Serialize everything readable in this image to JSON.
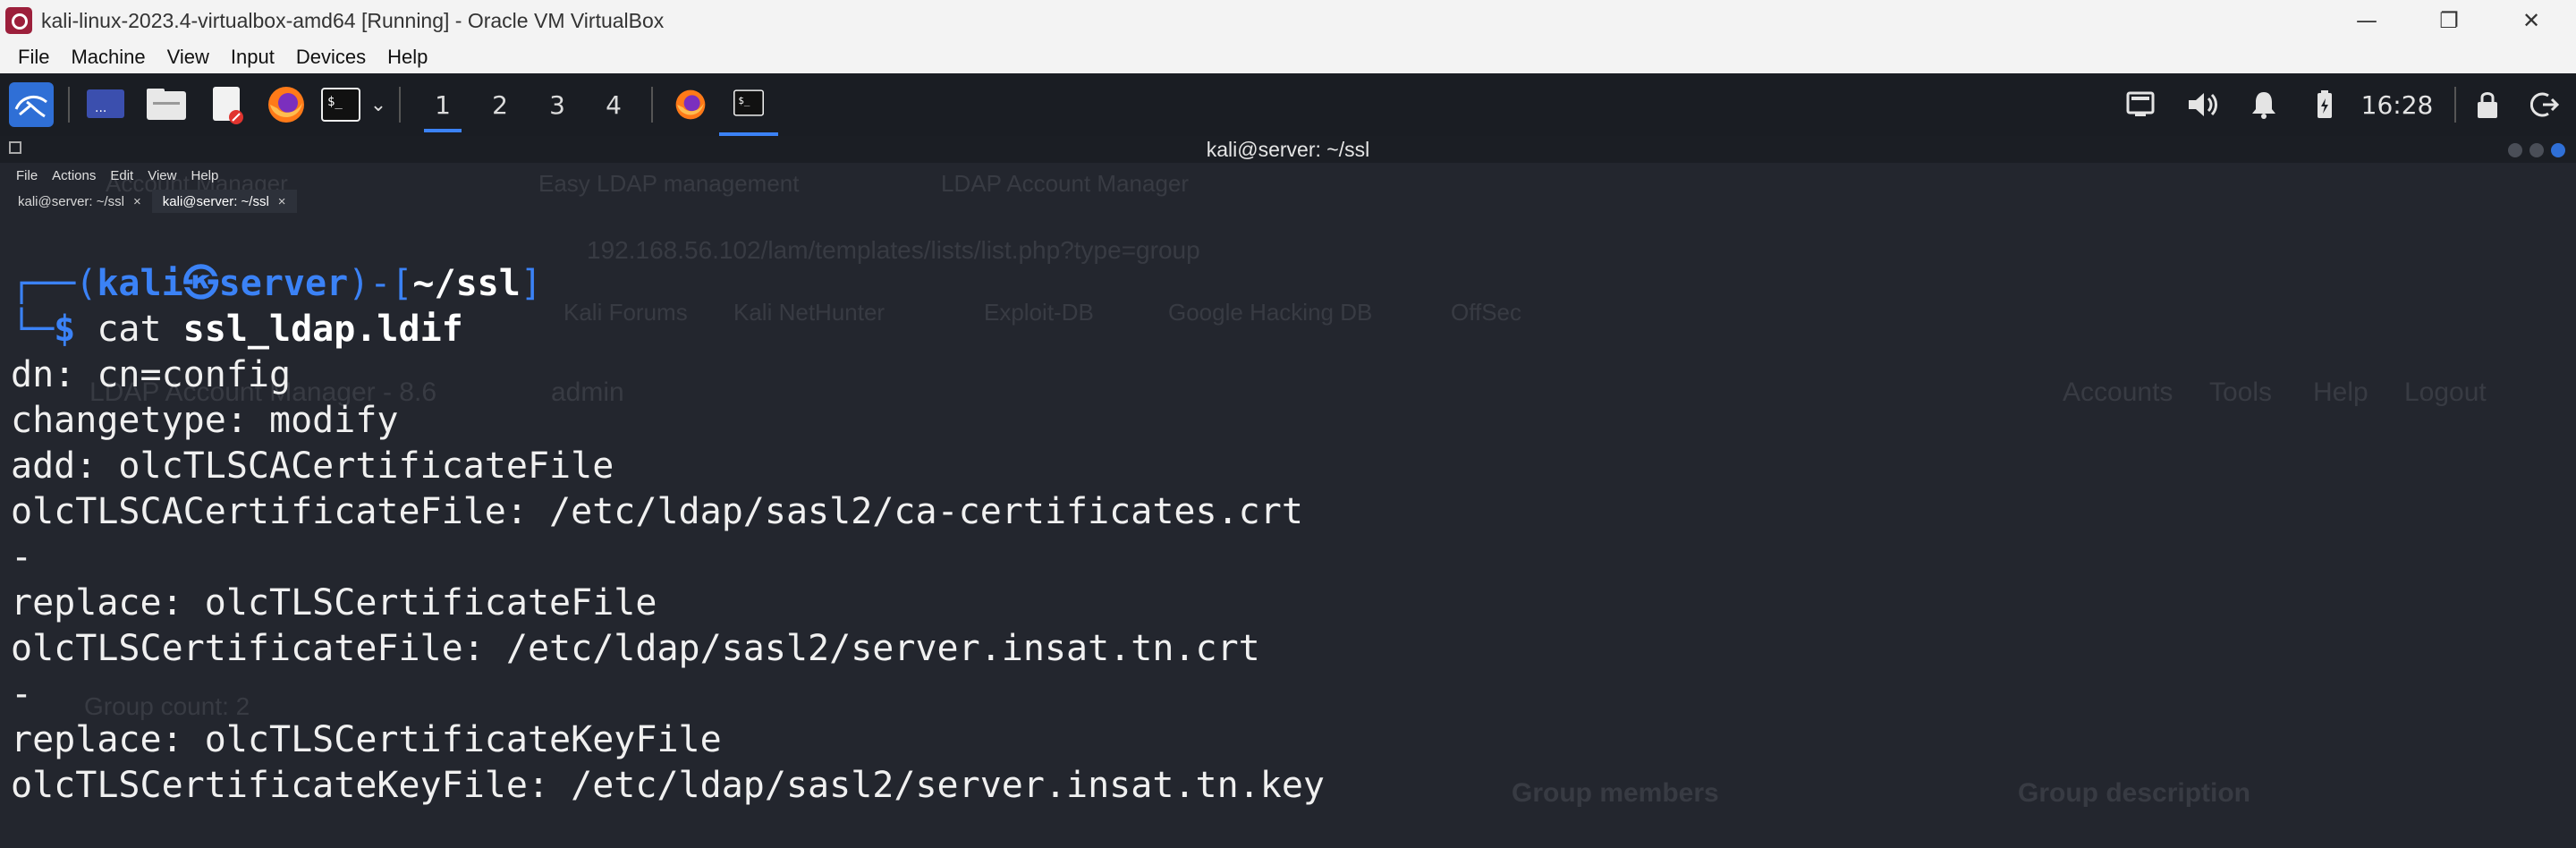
{
  "host_window": {
    "title": "kali-linux-2023.4-virtualbox-amd64 [Running] - Oracle VM VirtualBox"
  },
  "vbox_menu": [
    "File",
    "Machine",
    "View",
    "Input",
    "Devices",
    "Help"
  ],
  "panel": {
    "workspaces": [
      "1",
      "2",
      "3",
      "4"
    ],
    "active_workspace": "1",
    "clock": "16:28"
  },
  "terminal": {
    "title": "kali@server: ~/ssl",
    "menu": [
      "File",
      "Actions",
      "Edit",
      "View",
      "Help"
    ],
    "tabs": [
      {
        "label": "kali@server: ~/ssl",
        "close": "×"
      },
      {
        "label": "kali@server: ~/ssl",
        "close": "×"
      }
    ],
    "prompt": {
      "frame_top_left": "┌──(",
      "user": "kali",
      "at_symbol": "㉿",
      "host": "server",
      "frame_mid": ")-[",
      "dir": "~/ssl",
      "frame_end": "]",
      "frame_bottom": "└─",
      "dollar": "$ ",
      "command_word": "cat ",
      "command_arg": "ssl_ldap.ldif"
    },
    "output_lines": [
      "dn: cn=config",
      "changetype: modify",
      "add: olcTLSCACertificateFile",
      "olcTLSCACertificateFile: /etc/ldap/sasl2/ca-certificates.crt",
      "-",
      "replace: olcTLSCertificateFile",
      "olcTLSCertificateFile: /etc/ldap/sasl2/server.insat.tn.crt",
      "-",
      "replace: olcTLSCertificateKeyFile",
      "olcTLSCertificateKeyFile: /etc/ldap/sasl2/server.insat.tn.key"
    ]
  },
  "background_browser": {
    "tabs": [
      "Account Manager",
      "Easy LDAP management",
      "LDAP Account Manager"
    ],
    "url": "192.168.56.102/lam/templates/lists/list.php?type=group",
    "bookmarks": [
      "Kali Forums",
      "Kali NetHunter",
      "Exploit-DB",
      "Google Hacking DB",
      "OffSec"
    ],
    "app_title": "LDAP Account Manager - 8.6",
    "user": "admin",
    "nav": [
      "Accounts",
      "Tools",
      "Help",
      "Logout"
    ],
    "group_count": "Group count: 2",
    "columns": [
      "Group members",
      "Group description"
    ]
  },
  "colors": {
    "terminal_bg": "#23262e",
    "prompt_blue": "#3b82f6",
    "panel_bg": "#1a1d23",
    "vbox_icon": "#9c1f3b"
  }
}
